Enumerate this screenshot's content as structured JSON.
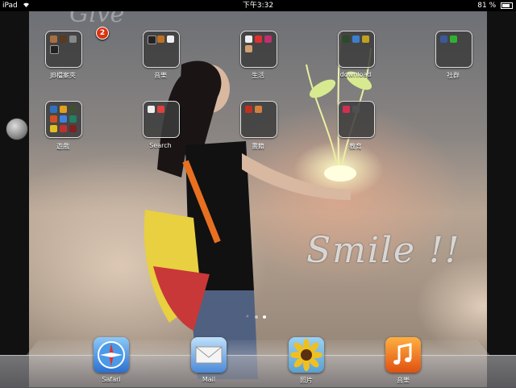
{
  "statusbar": {
    "device": "iPad",
    "time": "下午3:32",
    "battery": "81 %",
    "battery_level": 0.81
  },
  "folders": [
    {
      "label": "JB檔案夾",
      "badge": "2"
    },
    {
      "label": "音樂"
    },
    {
      "label": "生活"
    },
    {
      "label": "download"
    },
    {
      "label": "社群"
    },
    {
      "label": "遊戲"
    },
    {
      "label": "Search"
    },
    {
      "label": "書籍"
    },
    {
      "label": "教育"
    }
  ],
  "wallpaper_text": {
    "give": "Give",
    "smile": "Smile !!"
  },
  "dock": [
    {
      "label": "Safari",
      "icon": "safari-compass-icon"
    },
    {
      "label": "Mail",
      "icon": "mail-envelope-icon"
    },
    {
      "label": "照片",
      "icon": "photos-sunflower-icon"
    },
    {
      "label": "音樂",
      "icon": "music-note-icon"
    }
  ],
  "page_indicator": {
    "pages": 3,
    "current": 2
  },
  "colors": {
    "badge": "#dd3311",
    "music": "#f08020",
    "safari": "#3a8fe0"
  }
}
